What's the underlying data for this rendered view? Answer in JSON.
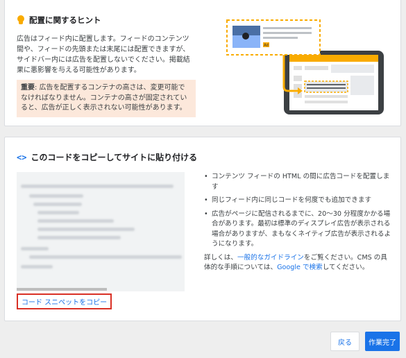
{
  "tips": {
    "title": "配置に関するヒント",
    "body": "広告はフィード内に配置します。フィードのコンテンツ間や、フィードの先頭または末尾には配置できますが、サイドバー内には広告を配置しないでください。掲載結果に悪影響を与える可能性があります。",
    "warning_label": "重要",
    "warning_text": ": 広告を配置するコンテナの高さは、変更可能でなければなりません。コンテナの高さが固定されていると、広告が正しく表示されない可能性があります。",
    "illustration_ad_badge": "Ad",
    "colors": {
      "accent_yellow": "#f9ab00",
      "device_dark": "#3c4043",
      "warn_bg": "#fce8db"
    }
  },
  "code": {
    "icon": "code-brackets-icon",
    "title": "このコードをコピーしてサイトに貼り付ける",
    "copy_link": "コード スニペットをコピー",
    "notes": [
      "コンテンツ フィードの HTML の間に広告コードを配置します",
      "同じフィード内に同じコードを何度でも追加できます",
      "広告がページに配信されるまでに、20～30 分程度かかる場合があります。最初は標準のディスプレイ広告が表示される場合がありますが、まもなくネイティブ広告が表示されるようになります。"
    ],
    "more_prefix": "詳しくは、",
    "more_link1": "一般的なガイドライン",
    "more_middle": "をご覧ください。CMS の具体的な手順については、",
    "more_link2": "Google で検索",
    "more_suffix": "してください。"
  },
  "footer": {
    "back_label": "戻る",
    "done_label": "作業完了",
    "colors": {
      "primary": "#1a73e8"
    }
  }
}
